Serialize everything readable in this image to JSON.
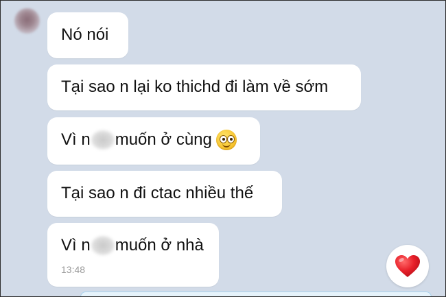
{
  "messages": [
    {
      "text": "Nó nói"
    },
    {
      "text": "Tại sao n lại ko thichd đi làm về sớm"
    },
    {
      "prefix": "Vì n",
      "suffix": "muốn ở cùng",
      "emoji": "smiling-face-icon"
    },
    {
      "text": "Tại sao n đi ctac nhiều thế"
    },
    {
      "prefix": "Vì n",
      "suffix": "muốn ở nhà",
      "time": "13:48"
    }
  ],
  "reaction": {
    "icon": "red-heart-icon",
    "color": "#e8202a"
  },
  "colors": {
    "chat_background": "#d2dbe8",
    "bubble": "#ffffff",
    "timestamp": "#9a9a9a"
  }
}
